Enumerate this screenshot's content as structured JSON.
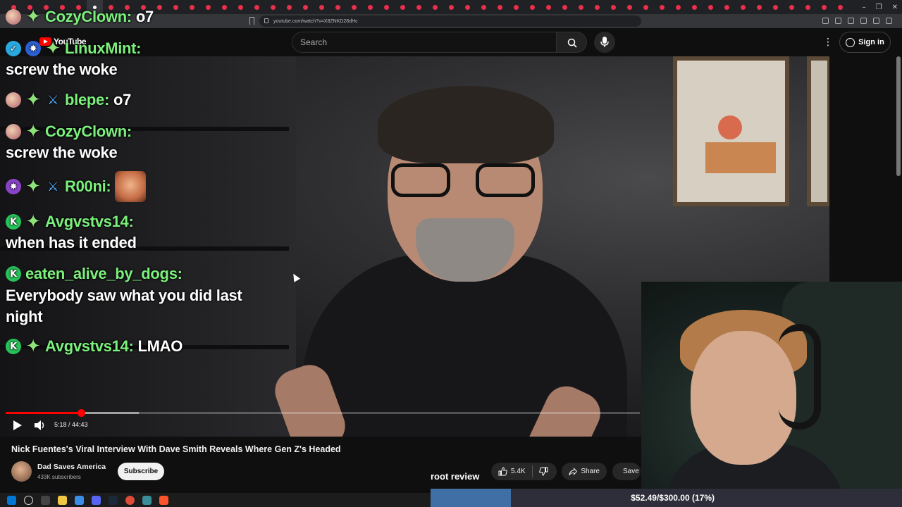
{
  "browser": {
    "url": "youtube.com/watch?v=X8ZNKD28dHc",
    "window_controls": [
      "–",
      "❐",
      "✕"
    ]
  },
  "youtube": {
    "logo": "YouTube",
    "search_placeholder": "Search",
    "sign_in": "Sign in",
    "more": "⋮"
  },
  "chat": [
    {
      "name": "CozyClown:",
      "text": "o7"
    },
    {
      "name": "LinuxMint:",
      "text": "screw the woke"
    },
    {
      "name": "blepe:",
      "text": "o7"
    },
    {
      "name": "CozyClown:",
      "text": "screw the woke"
    },
    {
      "name": "R00ni:",
      "text": ""
    },
    {
      "name": "Avgvstvs14:",
      "text": "when has it ended"
    },
    {
      "name": "eaten_alive_by_dogs:",
      "text": "Everybody saw what you did last",
      "text2": "night"
    },
    {
      "name": "Avgvstvs14:",
      "text": "LMAO"
    }
  ],
  "player": {
    "time": "5:18 / 44:43",
    "progress": 0.119,
    "buffered": 0.21
  },
  "video": {
    "title": "Nick Fuentes's Viral Interview With Dave Smith Reveals Where Gen Z's Headed",
    "channel": "Dad Saves America",
    "subscribers": "433K subscribers",
    "subscribe_label": "Subscribe",
    "likes": "5.4K",
    "share_label": "Share",
    "save_label": "Save"
  },
  "overlay": {
    "root_review": "root review",
    "donation_text": "$52.49/$300.00 (17%)",
    "donation_progress": 0.17
  },
  "colors": {
    "chat_name": "#7cf07c",
    "accent_red": "#ff0000",
    "donation_fill": "#3f6fa5"
  }
}
